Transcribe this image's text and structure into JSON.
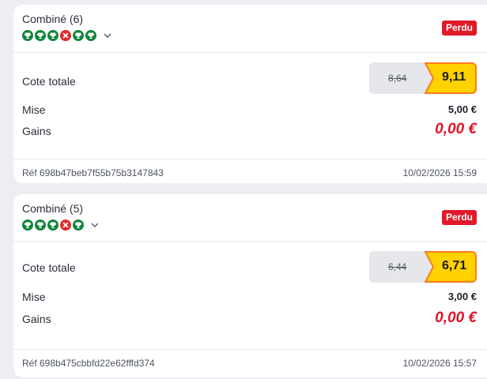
{
  "bets": [
    {
      "title": "Combiné (6)",
      "legs": [
        "won",
        "won",
        "won",
        "lost",
        "won",
        "won"
      ],
      "status": "Perdu",
      "cote_label": "Cote totale",
      "old_odds": "8,64",
      "new_odds": "9,11",
      "mise_label": "Mise",
      "mise_value": "5,00 €",
      "gains_label": "Gains",
      "gains_value": "0,00 €",
      "ref": "Réf 698b47beb7f55b75b3147843",
      "date": "10/02/2026 15:59"
    },
    {
      "title": "Combiné (5)",
      "legs": [
        "won",
        "won",
        "won",
        "lost",
        "won"
      ],
      "status": "Perdu",
      "cote_label": "Cote totale",
      "old_odds": "6,44",
      "new_odds": "6,71",
      "mise_label": "Mise",
      "mise_value": "3,00 €",
      "gains_label": "Gains",
      "gains_value": "0,00 €",
      "ref": "Réf 698b475cbbfd22e62fffd374",
      "date": "10/02/2026 15:57"
    }
  ],
  "colors": {
    "won": "#12853c",
    "lost": "#e02a2a",
    "badge": "#e1192b",
    "boost": "#ffd200",
    "boost_border": "#ff7a1a",
    "gains": "#e0142a"
  },
  "icons": {
    "won_leg": "trophy-icon",
    "lost_leg": "cross-icon",
    "expand": "chevron-down-icon"
  }
}
